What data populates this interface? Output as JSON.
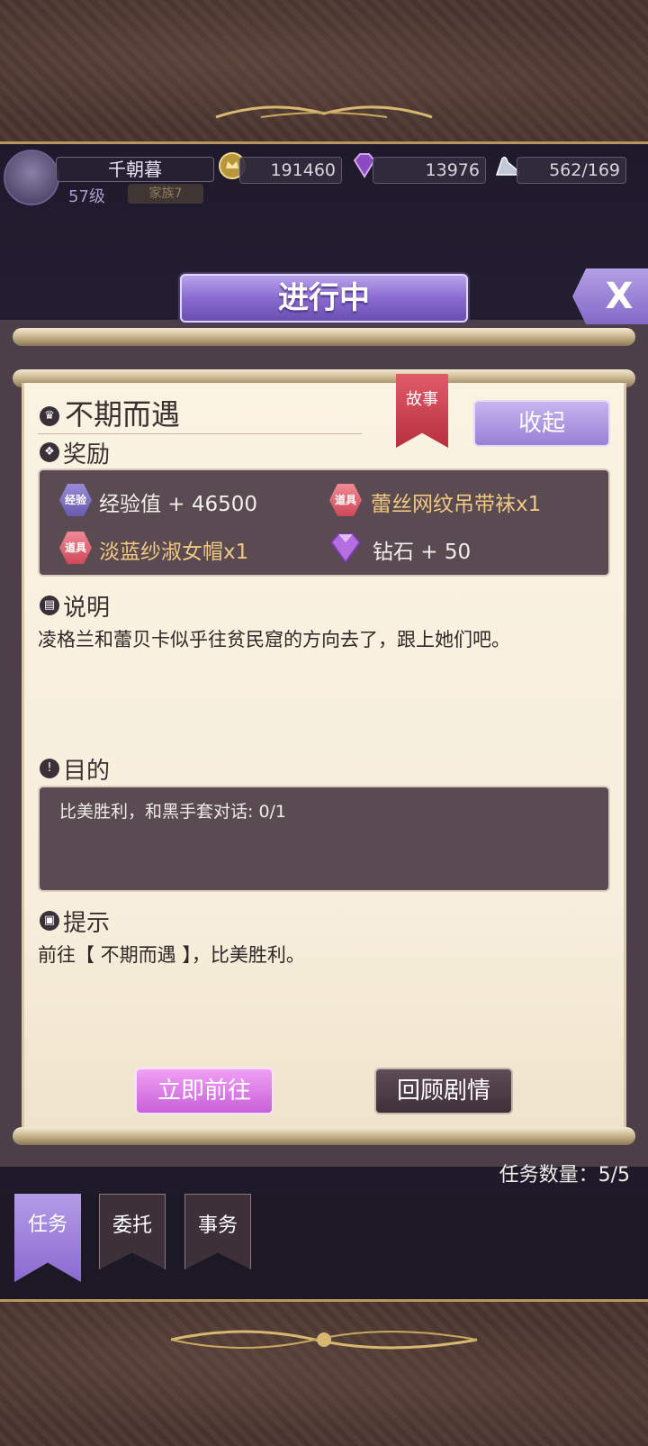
{
  "player": {
    "name": "千朝暮",
    "level": "57级",
    "family": "家族7"
  },
  "resources": {
    "gold": "191460",
    "diamond": "13976",
    "stamina": "562/169"
  },
  "panel": {
    "status_title": "进行中",
    "close_label": "X"
  },
  "quest": {
    "title": "不期而遇",
    "tag": "故事",
    "collapse_label": "收起",
    "reward_label": "奖励",
    "rewards": [
      {
        "badge": "经验",
        "text": "经验值 + 46500"
      },
      {
        "badge": "道具",
        "text": "蕾丝网纹吊带袜x1"
      },
      {
        "badge": "道具",
        "text": "淡蓝纱淑女帽x1"
      },
      {
        "badge": "diamond-icon",
        "text": "钻石 + 50"
      }
    ],
    "description_label": "说明",
    "description": "凌格兰和蕾贝卡似乎往贫民窟的方向去了，跟上她们吧。",
    "objective_label": "目的",
    "objective": "比美胜利，和黑手套对话: 0/1",
    "hint_label": "提示",
    "hint": "前往【 不期而遇 】，比美胜利。",
    "go_button": "立即前往",
    "review_button": "回顾剧情",
    "quest_count": "任务数量：5/5"
  },
  "tabs": [
    {
      "label": "任务",
      "active": true
    },
    {
      "label": "委托",
      "active": false
    },
    {
      "label": "事务",
      "active": false
    }
  ],
  "colors": {
    "accent": "#8a6cd0",
    "go_button": "#d070e0",
    "ribbon": "#d04858"
  }
}
